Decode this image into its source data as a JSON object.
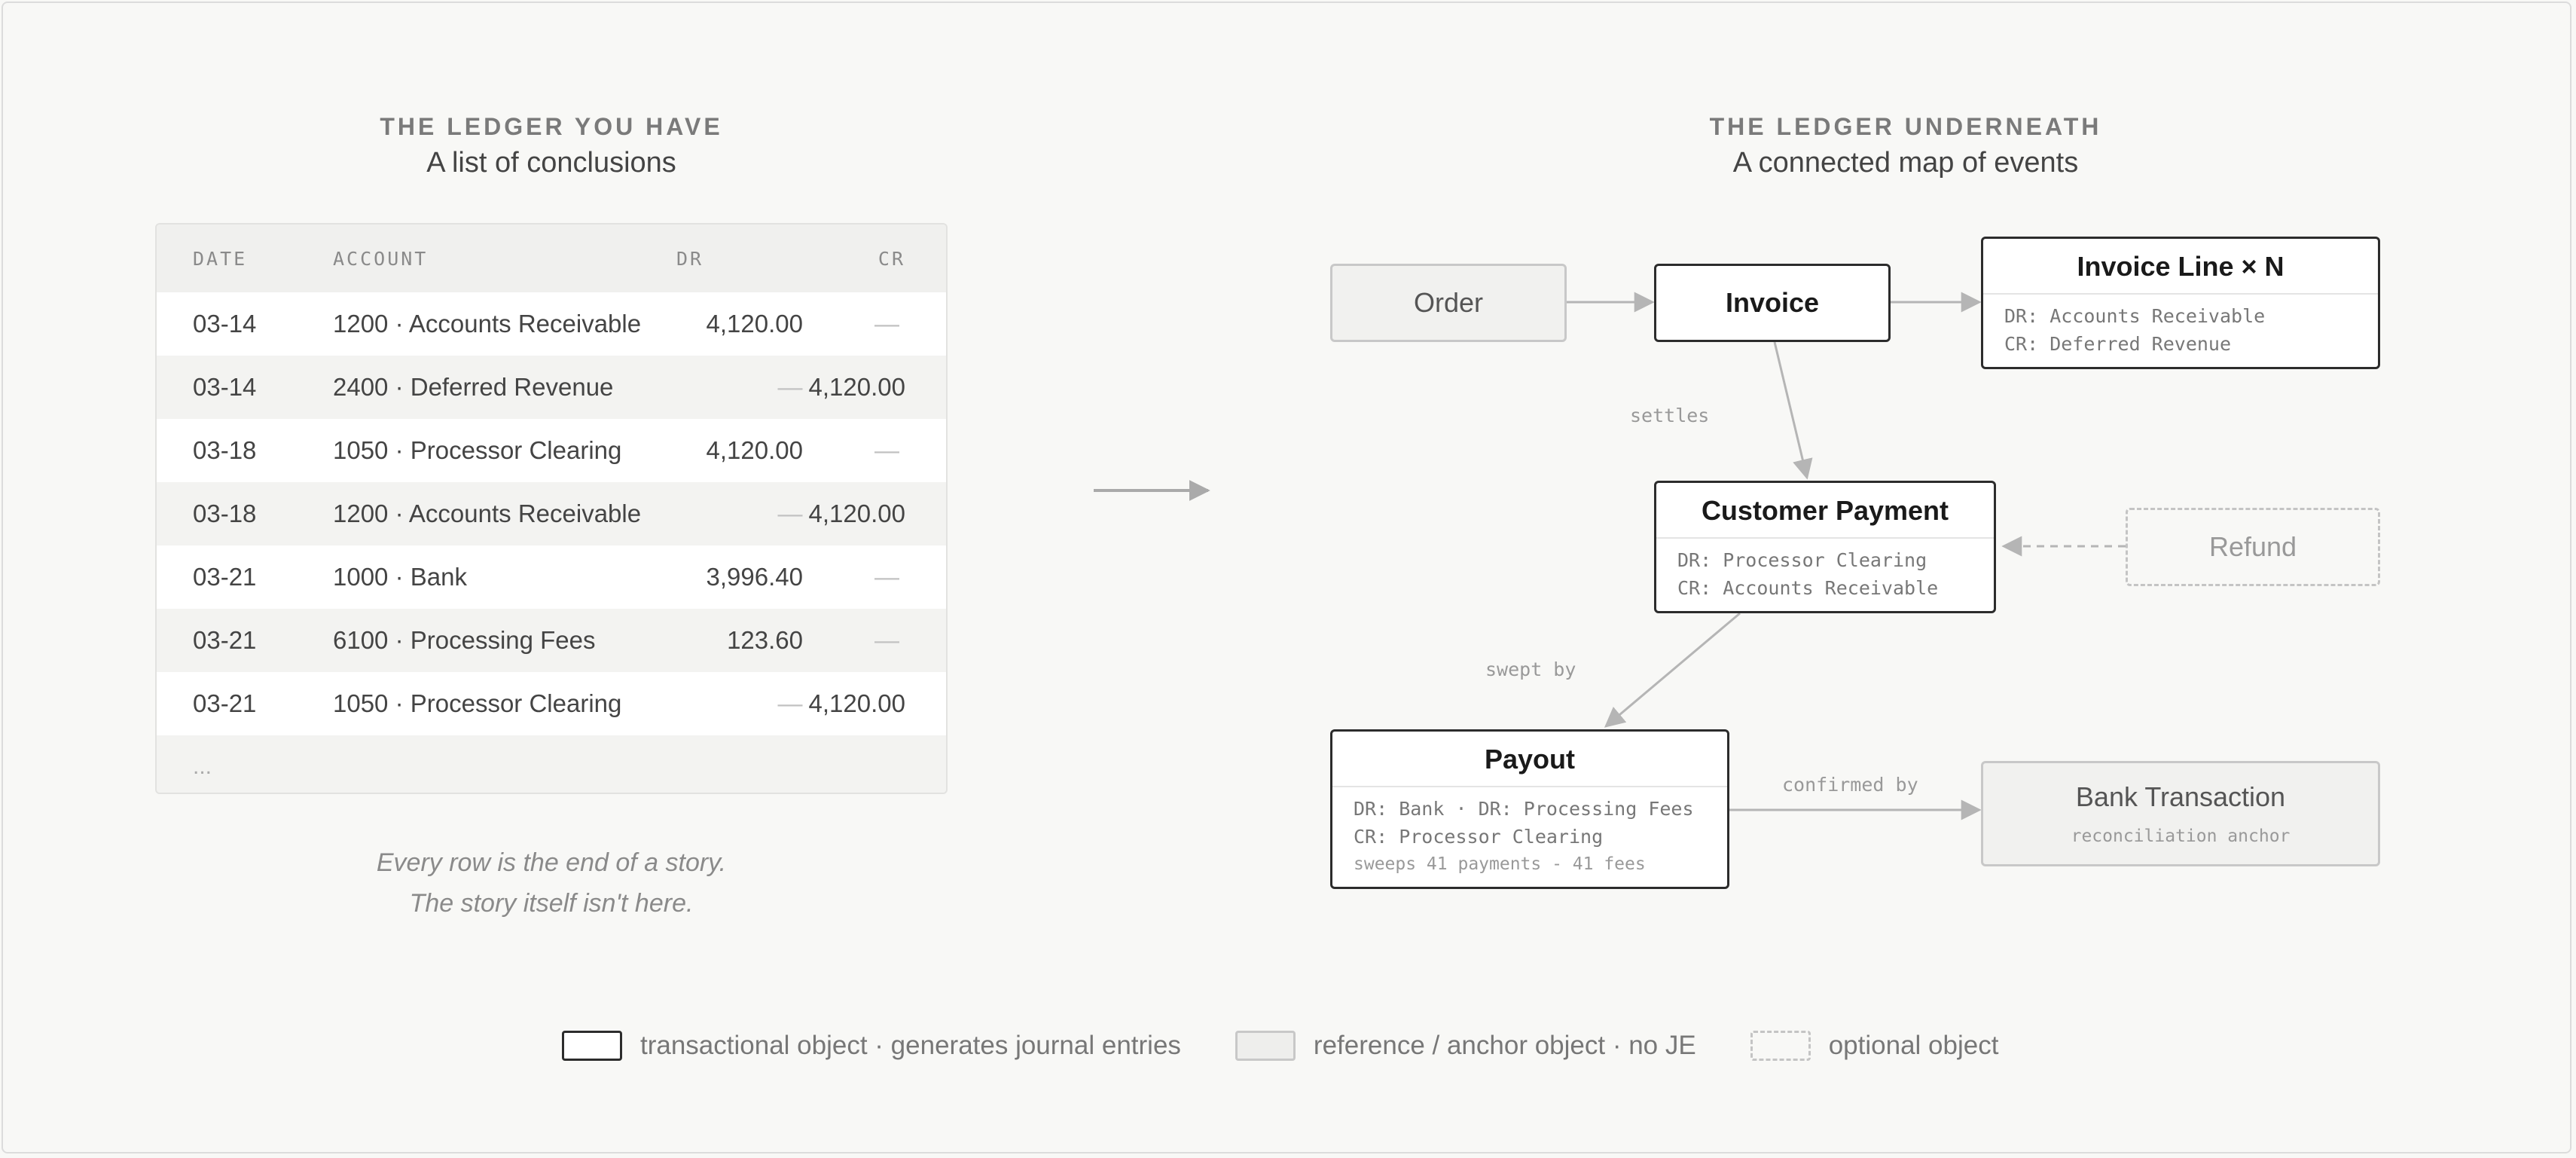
{
  "left": {
    "kicker": "THE LEDGER YOU HAVE",
    "subtitle": "A list of conclusions",
    "table": {
      "headers": {
        "date": "DATE",
        "account": "ACCOUNT",
        "dr": "DR",
        "cr": "CR"
      },
      "rows": [
        {
          "date": "03-14",
          "account": "1200 · Accounts Receivable",
          "dr": "4,120.00",
          "cr": "—"
        },
        {
          "date": "03-14",
          "account": "2400 · Deferred Revenue",
          "dr": "",
          "cr": "4,120.00"
        },
        {
          "date": "03-18",
          "account": "1050 · Processor Clearing",
          "dr": "4,120.00",
          "cr": "—"
        },
        {
          "date": "03-18",
          "account": "1200 · Accounts Receivable",
          "dr": "",
          "cr": "4,120.00"
        },
        {
          "date": "03-21",
          "account": "1000 · Bank",
          "dr": "3,996.40",
          "cr": "—"
        },
        {
          "date": "03-21",
          "account": "6100 · Processing Fees",
          "dr": "123.60",
          "cr": "—"
        },
        {
          "date": "03-21",
          "account": "1050 · Processor Clearing",
          "dr": "",
          "cr": "4,120.00"
        }
      ],
      "ellipsis": "...",
      "dash": "—"
    },
    "caption_line1": "Every row is the end of a story.",
    "caption_line2": "The story itself isn't here."
  },
  "right": {
    "kicker": "THE LEDGER UNDERNEATH",
    "subtitle": "A connected map of events",
    "nodes": {
      "order": {
        "title": "Order"
      },
      "invoice": {
        "title": "Invoice"
      },
      "invoice_line": {
        "title": "Invoice Line × N",
        "dr": "DR: Accounts Receivable",
        "cr": "CR: Deferred Revenue"
      },
      "customer_payment": {
        "title": "Customer Payment",
        "dr": "DR: Processor Clearing",
        "cr": "CR: Accounts Receivable"
      },
      "refund": {
        "title": "Refund"
      },
      "payout": {
        "title": "Payout",
        "dr": "DR: Bank · DR: Processing Fees",
        "cr": "CR: Processor Clearing",
        "note": "sweeps 41 payments - 41 fees"
      },
      "bank_transaction": {
        "title": "Bank Transaction",
        "sub": "reconciliation anchor"
      }
    },
    "edges": {
      "settles": "settles",
      "swept_by": "swept by",
      "confirmed_by": "confirmed by"
    }
  },
  "legend": {
    "transactional": "transactional object · generates journal entries",
    "reference": "reference / anchor object · no JE",
    "optional": "optional object"
  },
  "colors": {
    "background": "#f8f8f6",
    "border_dark": "#2c2c2c",
    "border_light": "#c8c8c8",
    "arrow": "#b5b5b5"
  }
}
